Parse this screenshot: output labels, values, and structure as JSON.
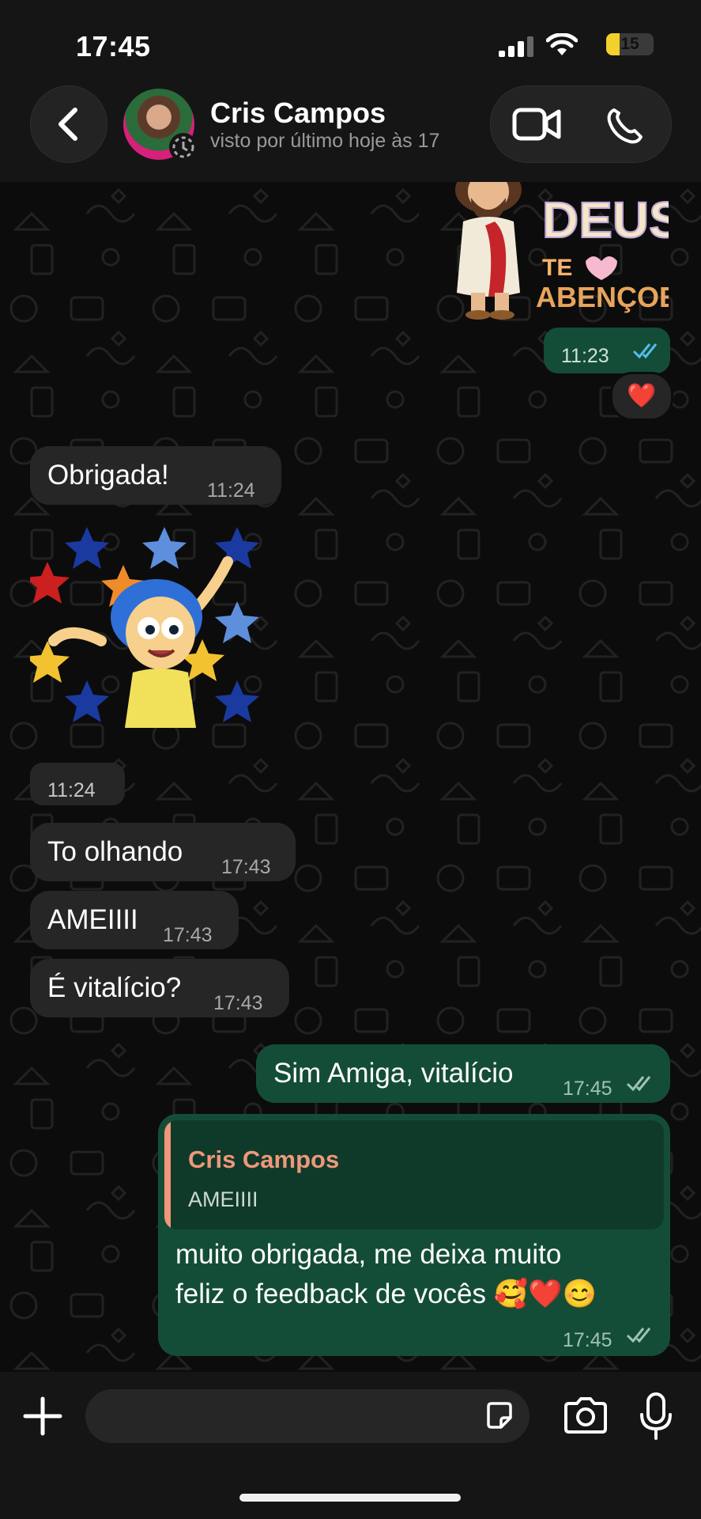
{
  "status_bar": {
    "time": "17:45",
    "battery": "15"
  },
  "header": {
    "contact_name": "Cris Campos",
    "contact_status": "visto por último hoje às 17",
    "icons": [
      "back-chevron-icon",
      "video-call-icon",
      "phone-icon"
    ]
  },
  "stickers": {
    "jesus": {
      "text_line1": "DEUS",
      "text_line2": "TE",
      "text_line3": "ABENÇOE!",
      "time": "11:23"
    },
    "inside_out_joy": {
      "time": "11:24"
    }
  },
  "reaction": "❤️",
  "messages": [
    {
      "direction": "in",
      "text": "Obrigada!",
      "time": "11:24"
    },
    {
      "direction": "in",
      "text": "To olhando",
      "time": "17:43"
    },
    {
      "direction": "in",
      "text": "AMEIIII",
      "time": "17:43"
    },
    {
      "direction": "in",
      "text": "É vitalício?",
      "time": "17:43"
    },
    {
      "direction": "out",
      "text": "Sim Amiga, vitalício",
      "time": "17:45"
    },
    {
      "direction": "out",
      "quote": {
        "name": "Cris Campos",
        "text": "AMEIIII"
      },
      "line1": "muito obrigada, me deixa muito",
      "line2": "feliz o feedback de vocês 🥰❤️😊",
      "time": "17:45"
    }
  ],
  "composer": {
    "icons": [
      "plus-icon",
      "sticker-icon",
      "camera-icon",
      "microphone-icon"
    ]
  },
  "colors": {
    "incoming": "#262626",
    "outgoing": "#144d37",
    "quote_accent": "#f0977a",
    "read_ticks": "#53bdeb"
  }
}
